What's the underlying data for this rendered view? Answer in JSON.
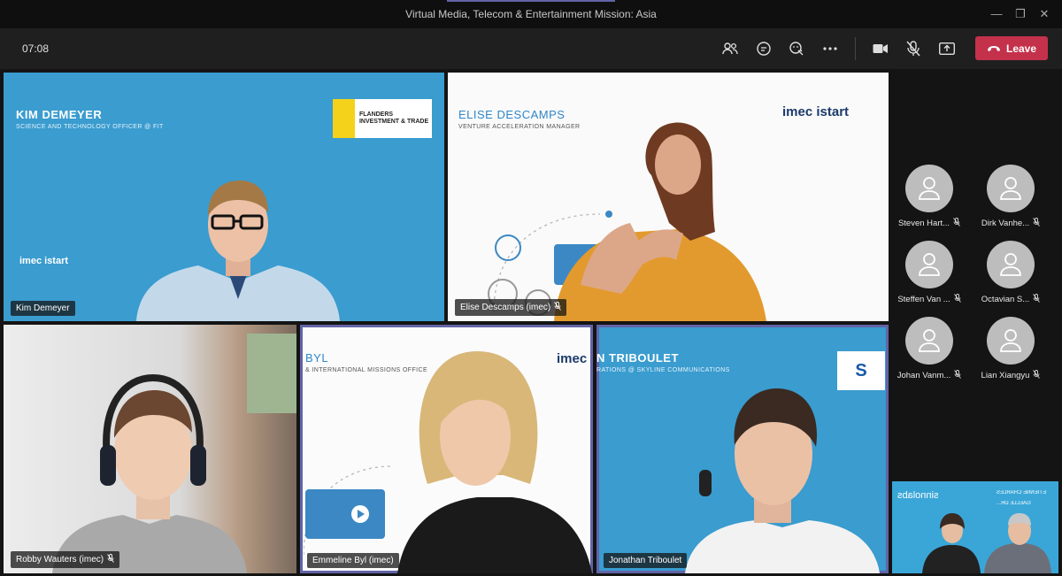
{
  "window": {
    "title": "Virtual Media, Telecom & Entertainment Mission: Asia"
  },
  "toolbar": {
    "timer": "07:08",
    "leave_label": "Leave"
  },
  "tiles": [
    {
      "name": "Kim Demeyer",
      "slide_name": "KIM DEMEYER",
      "slide_role": "SCIENCE AND TECHNOLOGY OFFICER @ FIT",
      "logo_text": "FLANDERS INVESTMENT & TRADE",
      "brand": "imec istart"
    },
    {
      "name": "Elise Descamps (imec)",
      "slide_name": "ELISE DESCAMPS",
      "slide_role": "VENTURE ACCELERATION MANAGER",
      "logo_text": "imec istart"
    },
    {
      "name": "Robby Wauters (imec)"
    },
    {
      "name": "Emmeline Byl (imec)",
      "slide_name": "BYL",
      "slide_role": "& INTERNATIONAL MISSIONS OFFICE",
      "logo_text": "imec"
    },
    {
      "name": "Jonathan Triboulet",
      "slide_name": "N TRIBOULET",
      "slide_role": "RATIONS @ SKYLINE COMMUNICATIONS",
      "logo_text": "S"
    }
  ],
  "attendees": [
    {
      "name": "Steven Hart..."
    },
    {
      "name": "Dirk Vanhe..."
    },
    {
      "name": "Steffen Van ..."
    },
    {
      "name": "Octavian S..."
    },
    {
      "name": "Johan Vanm..."
    },
    {
      "name": "Lian Xiangyu"
    }
  ],
  "self_view": {
    "brand": "sinnolabs",
    "caption1": "ETIENNE CHARLES",
    "caption2": "GAELLE DR..."
  }
}
